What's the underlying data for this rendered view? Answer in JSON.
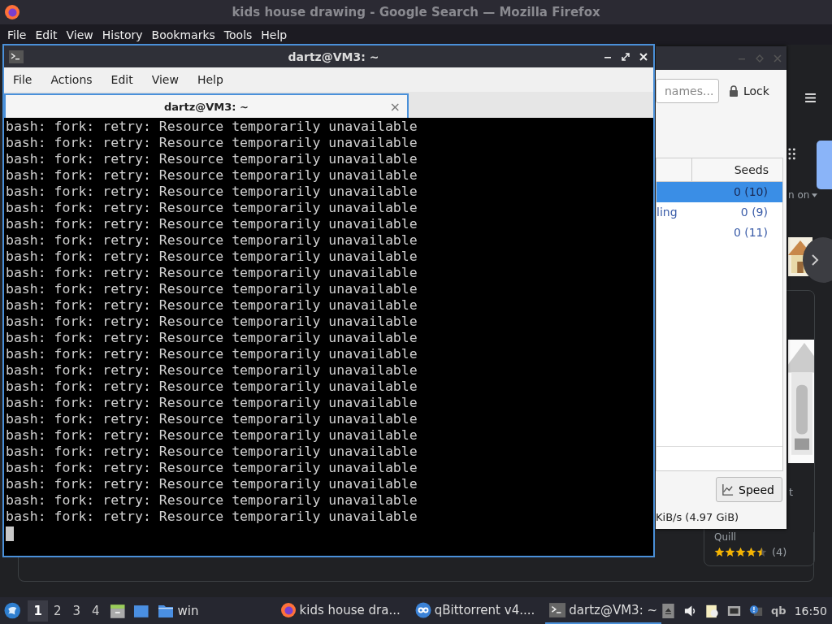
{
  "firefox": {
    "title": "kids house drawing - Google Search — Mozilla Firefox",
    "menu": [
      "File",
      "Edit",
      "View",
      "History",
      "Bookmarks",
      "Tools",
      "Help"
    ],
    "page": {
      "filter_label": "n on",
      "card": {
        "title_fragment": "t",
        "author": "Quill",
        "stars": 4.5,
        "count": "(4)"
      }
    }
  },
  "qbittorrent": {
    "search_placeholder": "names...",
    "lock_button": "Lock",
    "columns": [
      "Seeds"
    ],
    "rows": [
      {
        "name": "",
        "seeds": "0 (10)",
        "selected": true
      },
      {
        "name": "ling",
        "seeds": "0 (9)",
        "selected": false
      },
      {
        "name": "",
        "seeds": "0 (11)",
        "selected": false
      }
    ],
    "speed_button": "Speed",
    "status": "KiB/s (4.97 GiB)"
  },
  "terminal": {
    "title": "dartz@VM3: ~",
    "menu": [
      "File",
      "Actions",
      "Edit",
      "View",
      "Help"
    ],
    "tab": "dartz@VM3: ~",
    "tab_close": "×",
    "lines": [
      "bash: fork: retry: Resource temporarily unavailable",
      "bash: fork: retry: Resource temporarily unavailable",
      "bash: fork: retry: Resource temporarily unavailable",
      "bash: fork: retry: Resource temporarily unavailable",
      "bash: fork: retry: Resource temporarily unavailable",
      "bash: fork: retry: Resource temporarily unavailable",
      "bash: fork: retry: Resource temporarily unavailable",
      "bash: fork: retry: Resource temporarily unavailable",
      "bash: fork: retry: Resource temporarily unavailable",
      "bash: fork: retry: Resource temporarily unavailable",
      "bash: fork: retry: Resource temporarily unavailable",
      "bash: fork: retry: Resource temporarily unavailable",
      "bash: fork: retry: Resource temporarily unavailable",
      "bash: fork: retry: Resource temporarily unavailable",
      "bash: fork: retry: Resource temporarily unavailable",
      "bash: fork: retry: Resource temporarily unavailable",
      "bash: fork: retry: Resource temporarily unavailable",
      "bash: fork: retry: Resource temporarily unavailable",
      "bash: fork: retry: Resource temporarily unavailable",
      "bash: fork: retry: Resource temporarily unavailable",
      "bash: fork: retry: Resource temporarily unavailable",
      "bash: fork: retry: Resource temporarily unavailable",
      "bash: fork: retry: Resource temporarily unavailable",
      "bash: fork: retry: Resource temporarily unavailable",
      "bash: fork: retry: Resource temporarily unavailable"
    ]
  },
  "taskbar": {
    "workspaces": [
      {
        "label": "1",
        "selected": true
      },
      {
        "label": "2",
        "selected": false
      },
      {
        "label": "3",
        "selected": false
      },
      {
        "label": "4",
        "selected": false
      }
    ],
    "folder_label": "win",
    "tasks": [
      {
        "kind": "firefox",
        "label": "kids house dra...",
        "selected": false
      },
      {
        "kind": "qbittorrent",
        "label": "qBittorrent v4....",
        "selected": false
      },
      {
        "kind": "terminal",
        "label": "dartz@VM3: ~",
        "selected": true
      }
    ],
    "tray_qb": "qb",
    "clock": "16:50"
  }
}
